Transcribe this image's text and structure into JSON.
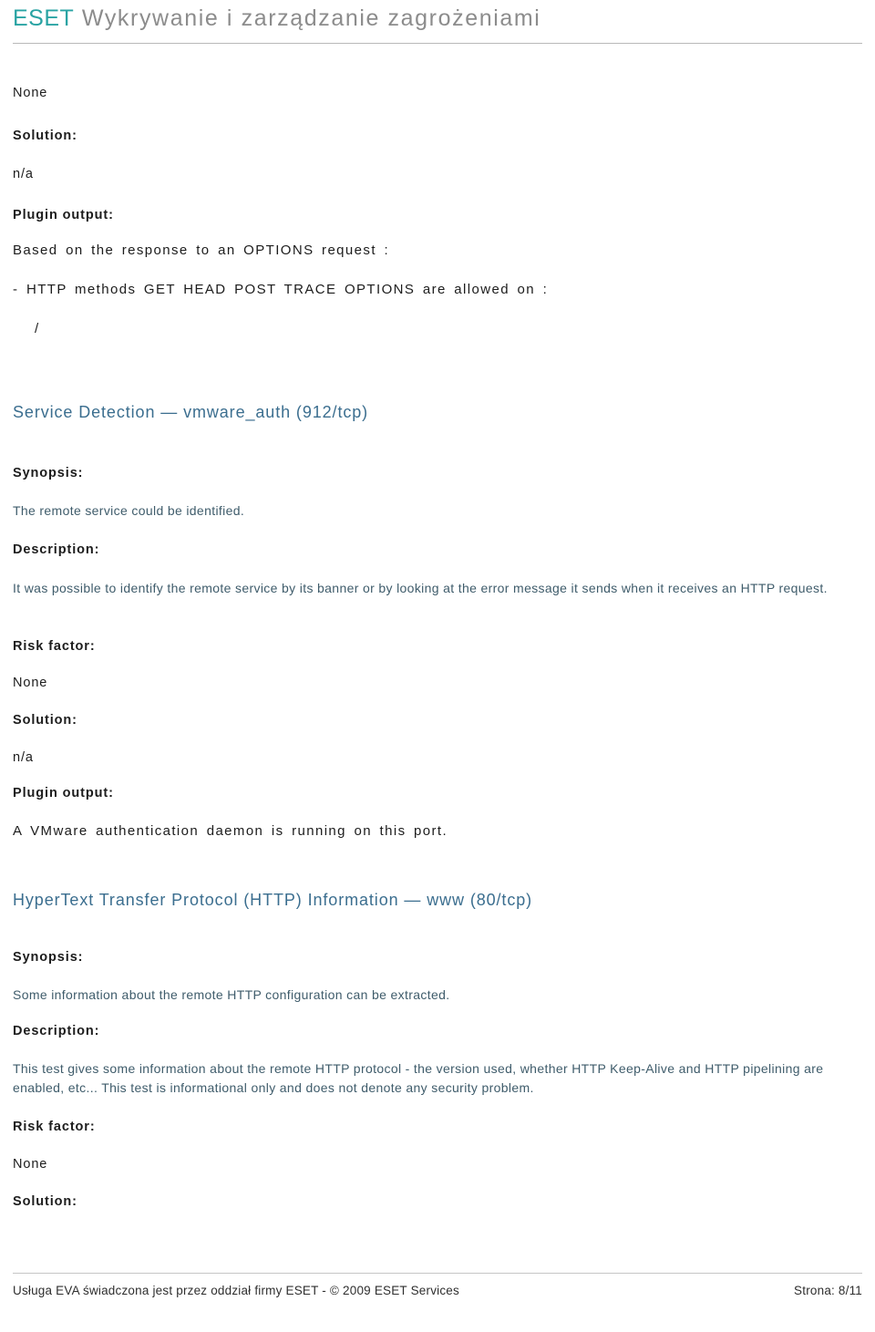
{
  "header": {
    "brand": "ESET",
    "title": "Wykrywanie i zarządzanie zagrożeniami"
  },
  "sections": [
    {
      "risk_value": "None",
      "solution_label": "Solution:",
      "solution_value": "n/a",
      "plugin_label": "Plugin output:",
      "plugin_lines": [
        "Based on the response to an OPTIONS request :",
        "- HTTP methods GET HEAD POST TRACE OPTIONS are allowed on :",
        "/"
      ]
    }
  ],
  "service_detection": {
    "title": "Service Detection — vmware_auth (912/tcp)",
    "synopsis_label": "Synopsis:",
    "synopsis_text": "The remote service could be identified.",
    "description_label": "Description:",
    "description_text": "It was possible to identify the remote service by its banner or by looking at the error message it sends when it receives an HTTP request.",
    "risk_label": "Risk factor:",
    "risk_value": "None",
    "solution_label": "Solution:",
    "solution_value": "n/a",
    "plugin_label": "Plugin output:",
    "plugin_text": "A VMware authentication daemon is running on this port."
  },
  "http_info": {
    "title": "HyperText Transfer Protocol (HTTP) Information — www (80/tcp)",
    "synopsis_label": "Synopsis:",
    "synopsis_text": "Some information about the remote HTTP configuration can be extracted.",
    "description_label": "Description:",
    "description_text": "This test gives some information about the remote HTTP protocol - the version used, whether HTTP Keep-Alive and HTTP pipelining are enabled, etc... This test is informational only and does not denote any security problem.",
    "risk_label": "Risk factor:",
    "risk_value": "None",
    "solution_label": "Solution:"
  },
  "footer": {
    "left": "Usługa EVA świadczona jest przez oddział firmy ESET - © 2009 ESET Services",
    "right": "Strona: 8/11"
  }
}
